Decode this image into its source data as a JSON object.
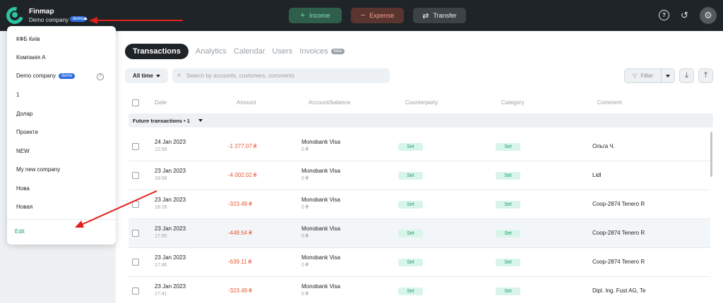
{
  "app": {
    "name": "Finmap",
    "company": "Demo company",
    "company_badge": "demo"
  },
  "topbar": {
    "income": "Income",
    "expense": "Expense",
    "transfer": "Transfer",
    "income_icon": "+",
    "expense_icon": "−",
    "transfer_icon": "⇄"
  },
  "tabs": [
    {
      "label": "Transactions",
      "active": true
    },
    {
      "label": "Analytics"
    },
    {
      "label": "Calendar"
    },
    {
      "label": "Users"
    },
    {
      "label": "Invoices",
      "badge": "beta"
    }
  ],
  "toolbar": {
    "period": "All time",
    "search_placeholder": "Search by accounts, customers, comments",
    "filter": "Filter"
  },
  "table": {
    "headers": [
      "Date",
      "Amount",
      "Account/balance",
      "Counterparty",
      "Category",
      "Comment"
    ],
    "group": "Future transactions • 1",
    "set_label": "Set",
    "rows": [
      {
        "date": "24 Jan 2023",
        "time": "12:59",
        "amount": "-1 277.07 ₴",
        "account": "Monobank Visa",
        "balance": "0 ₴",
        "comment": "Ольга Ч."
      },
      {
        "date": "23 Jan 2023",
        "time": "18:58",
        "amount": "-4 002.02 ₴",
        "account": "Monobank Visa",
        "balance": "0 ₴",
        "comment": "Lidl"
      },
      {
        "date": "23 Jan 2023",
        "time": "18:16",
        "amount": "-323.49 ₴",
        "account": "Monobank Visa",
        "balance": "0 ₴",
        "comment": "Coop-2874 Tenero R"
      },
      {
        "date": "23 Jan 2023",
        "time": "17:55",
        "amount": "-448.54 ₴",
        "account": "Monobank Visa",
        "balance": "0 ₴",
        "comment": "Coop-2874 Tenero R"
      },
      {
        "date": "23 Jan 2023",
        "time": "17:46",
        "amount": "-639.11 ₴",
        "account": "Monobank Visa",
        "balance": "0 ₴",
        "comment": "Coop-2874 Tenero R"
      },
      {
        "date": "23 Jan 2023",
        "time": "17:41",
        "amount": "-323.49 ₴",
        "account": "Monobank Visa",
        "balance": "0 ₴",
        "comment": "Dipl. Ing. Fust AG, Te"
      }
    ]
  },
  "dropdown": {
    "items": [
      "КФБ Київ",
      "Компанія А",
      "Demo company",
      "1",
      "Долар",
      "Проекти",
      "NEW",
      "My new company",
      "Нова",
      "Новая"
    ],
    "demo_badge": "demo",
    "edit": "Edit"
  },
  "colors": {
    "accent": "#1d9e75",
    "negative": "#e8542e",
    "topbar": "#1f2428",
    "annotation_arrow": "#e0201b"
  }
}
